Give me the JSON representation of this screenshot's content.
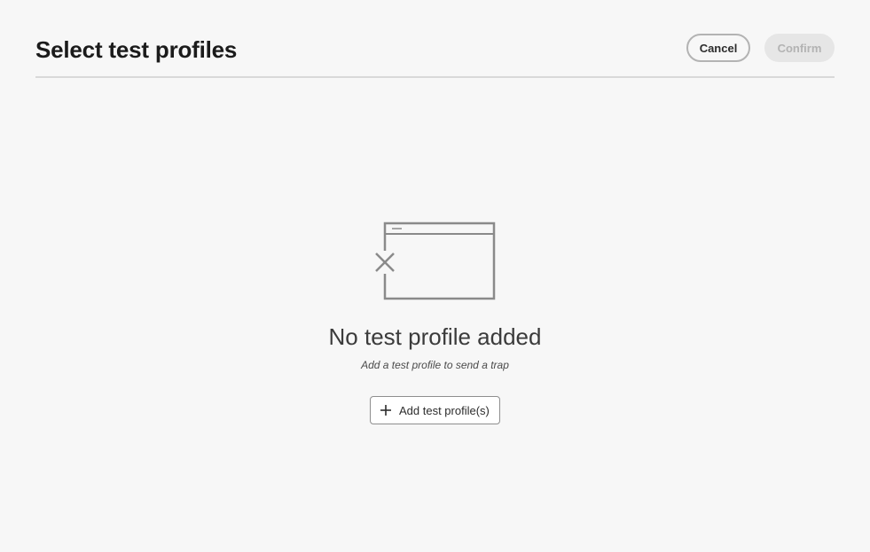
{
  "dialog": {
    "title": "Select test profiles",
    "actions": {
      "cancel_label": "Cancel",
      "confirm_label": "Confirm"
    }
  },
  "empty_state": {
    "heading": "No test profile added",
    "subtext": "Add a test profile to send a trap",
    "add_button_label": "Add test profile(s)",
    "illustration_icon": "empty-window-icon",
    "add_icon": "plus-icon"
  },
  "colors": {
    "background": "#f7f7f7",
    "divider": "#d9d9d9",
    "confirm_disabled_bg": "#e6e6e6",
    "confirm_disabled_text": "#b3b3b3",
    "illustration_stroke": "#8a8a8a"
  }
}
